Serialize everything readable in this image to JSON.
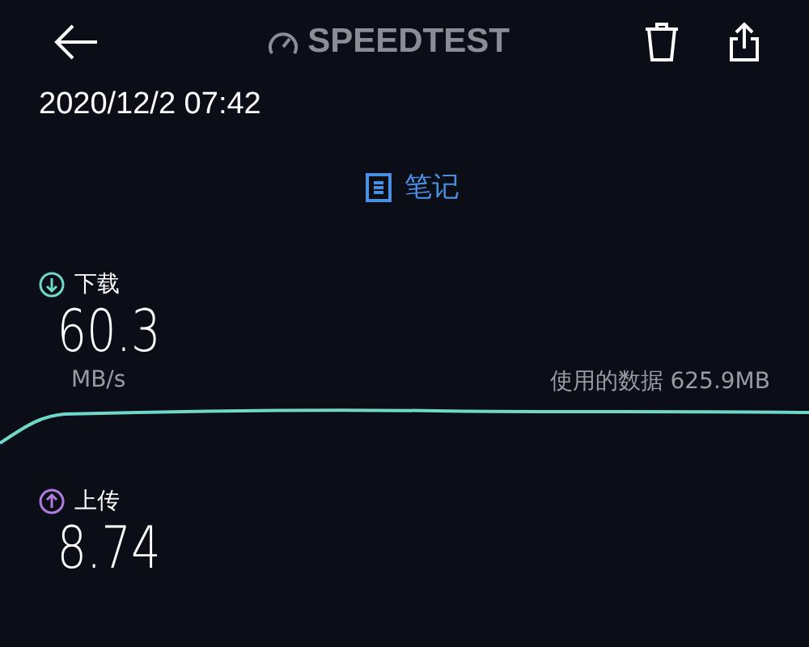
{
  "header": {
    "logo": "SPEEDTEST"
  },
  "date": "2020/12/2 07:42",
  "note": {
    "label": "笔记"
  },
  "results": [
    {
      "kind": "download",
      "label": "下载",
      "value": "60.3",
      "unit": "MB/s",
      "data_used": "使用的数据 625.9MB",
      "color": "#6fd8c9"
    },
    {
      "kind": "upload",
      "label": "上传",
      "value": "8.74",
      "color": "#b07ce0"
    }
  ]
}
